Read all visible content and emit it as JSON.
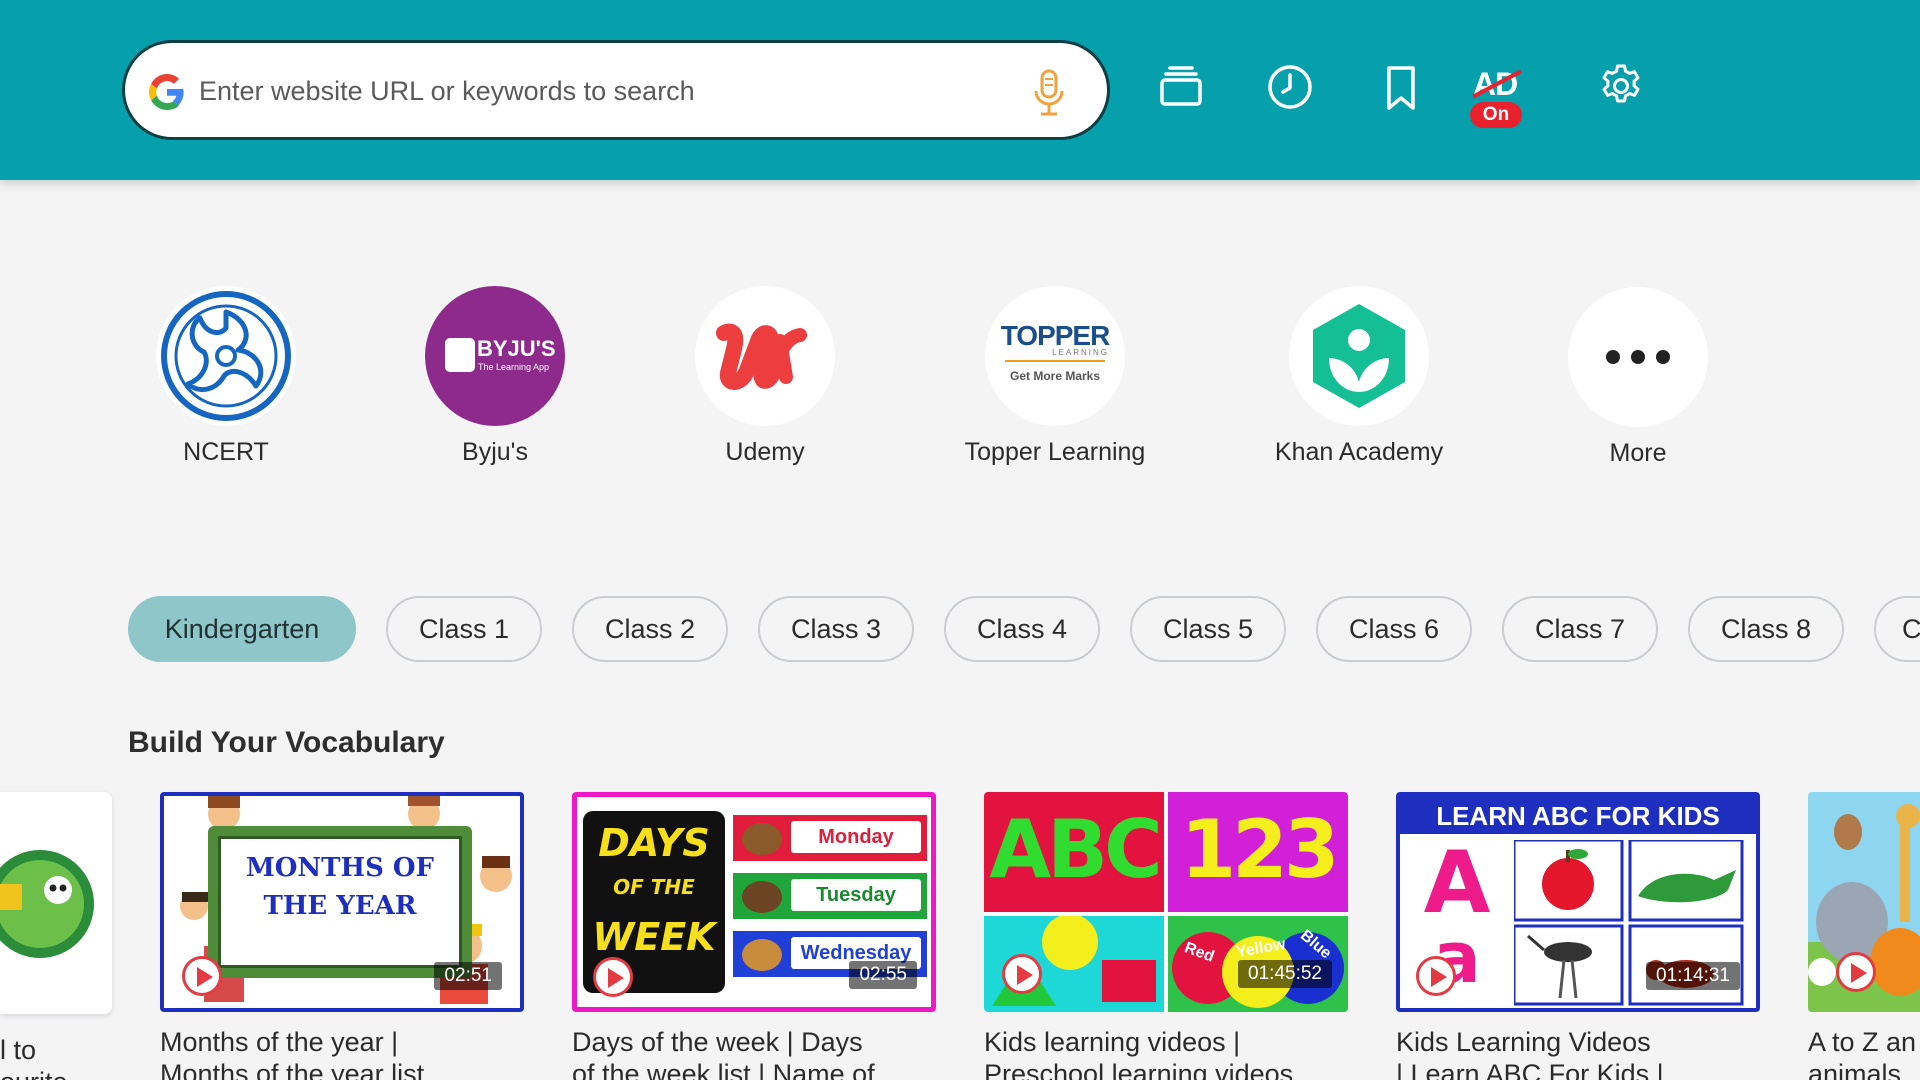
{
  "search": {
    "placeholder": "Enter website URL or keywords to search"
  },
  "toolbar": {
    "ad_label": "AD",
    "ad_badge": "On",
    "icons": [
      "tabs-icon",
      "history-icon",
      "bookmark-icon",
      "ad-block-icon",
      "settings-icon"
    ]
  },
  "colors": {
    "topbar": "#06a0ad",
    "active_chip": "#8fc6ca",
    "accent_red": "#e8212c",
    "mic": "#f0a23c"
  },
  "shortcuts": [
    {
      "label": "NCERT"
    },
    {
      "label": "Byju's",
      "logo_text": "BYJU'S",
      "logo_sub": "The Learning App"
    },
    {
      "label": "Udemy"
    },
    {
      "label": "Topper Learning",
      "logo_text": "TOPPER",
      "logo_mid": "LEARNING",
      "logo_sub": "Get More Marks"
    },
    {
      "label": "Khan Academy"
    },
    {
      "label": "More"
    }
  ],
  "chips": [
    "Kindergarten",
    "Class 1",
    "Class 2",
    "Class 3",
    "Class 4",
    "Class 5",
    "Class 6",
    "Class 7",
    "Class 8",
    "C"
  ],
  "section": {
    "title": "Build Your Vocabulary",
    "left_partial": {
      "line1": "l to",
      "line2": "ourite"
    },
    "cards": [
      {
        "thumb_line1": "MONTHS OF",
        "thumb_line2": "THE YEAR",
        "duration": "02:51",
        "title_line1": "Months of the year |",
        "title_line2": "Months of the year list"
      },
      {
        "thumb_line1": "DAYS",
        "thumb_line2": "OF THE",
        "thumb_line3": "WEEK",
        "day1": "Monday",
        "day2": "Tuesday",
        "day3": "Wednesday",
        "duration": "02:55",
        "title_line1": "Days of the week | Days",
        "title_line2": "of the week list | Name of"
      },
      {
        "thumb_line1": "ABC",
        "thumb_line2": "123",
        "ball1": "Red",
        "ball2": "Yellow",
        "ball3": "Blue",
        "duration": "01:45:52",
        "title_line1": "Kids learning videos |",
        "title_line2": "Preschool learning videos"
      },
      {
        "thumb_line1": "LEARN ABC FOR KIDS",
        "letter1": "A",
        "letter2": "a",
        "duration": "01:14:31",
        "title_line1": "Kids Learning Videos",
        "title_line2": "| Learn ABC For Kids |"
      },
      {
        "title_line1": "A to Z an",
        "title_line2": "animals"
      }
    ]
  }
}
